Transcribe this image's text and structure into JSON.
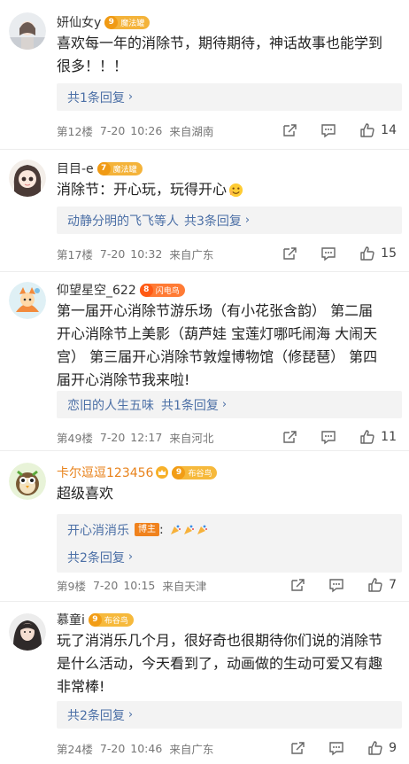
{
  "comments": [
    {
      "username": "妍仙女y",
      "crown": false,
      "badge": {
        "level": "9",
        "label": "魔法罐",
        "kind": "magic"
      },
      "lines": [
        "喜欢每一年的消除节，期待期待，神话故事也能学到",
        "很多！！！"
      ],
      "reply": {
        "prefix": "",
        "text": "共1条回复"
      },
      "floor": "第12楼",
      "date": "7-20",
      "time": "10:26",
      "location": "来自湖南",
      "likes": "14"
    },
    {
      "username": "目目-e",
      "crown": false,
      "badge": {
        "level": "7",
        "label": "魔法罐",
        "kind": "magic"
      },
      "lines": [
        "消除节：开心玩，玩得开心"
      ],
      "reply": {
        "prefix": "动静分明的飞飞等人",
        "text": "共3条回复"
      },
      "floor": "第17楼",
      "date": "7-20",
      "time": "10:32",
      "location": "来自广东",
      "likes": "15"
    },
    {
      "username": "仰望星空_622",
      "crown": false,
      "badge": {
        "level": "8",
        "label": "闪电鸟",
        "kind": "flash"
      },
      "lines": [
        "第一届开心消除节游乐场（有小花张含韵） 第二届",
        "开心消除节上美影（葫芦娃 宝莲灯哪吒闹海 大闹天",
        "宫） 第三届开心消除节敦煌博物馆（修琵琶） 第四",
        "届开心消除节我来啦!"
      ],
      "reply": {
        "prefix": "恋旧的人生五味",
        "text": "共1条回复"
      },
      "floor": "第49楼",
      "date": "7-20",
      "time": "12:17",
      "location": "来自河北",
      "likes": "11"
    },
    {
      "username": "卡尔逗逗123456",
      "crown": true,
      "badge": {
        "level": "9",
        "label": "布谷鸟",
        "kind": "bugu"
      },
      "lines": [
        "超级喜欢"
      ],
      "boss_reply": {
        "name": "开心消消乐",
        "tag": "博主"
      },
      "reply": {
        "prefix": "",
        "text": "共2条回复"
      },
      "floor": "第9楼",
      "date": "7-20",
      "time": "10:15",
      "location": "来自天津",
      "likes": "7"
    },
    {
      "username": "慕童i",
      "crown": false,
      "badge": {
        "level": "9",
        "label": "布谷鸟",
        "kind": "bugu"
      },
      "lines": [
        "玩了消消乐几个月，很好奇也很期待你们说的消除节",
        "是什么活动，今天看到了，动画做的生动可爱又有趣",
        "非常棒!"
      ],
      "reply": {
        "prefix": "",
        "text": "共2条回复"
      },
      "floor": "第24楼",
      "date": "7-20",
      "time": "10:46",
      "location": "来自广东",
      "likes": "9"
    }
  ],
  "colors": {
    "link": "#4b6fa6",
    "gold_name": "#e8821a",
    "meta": "#777777"
  }
}
